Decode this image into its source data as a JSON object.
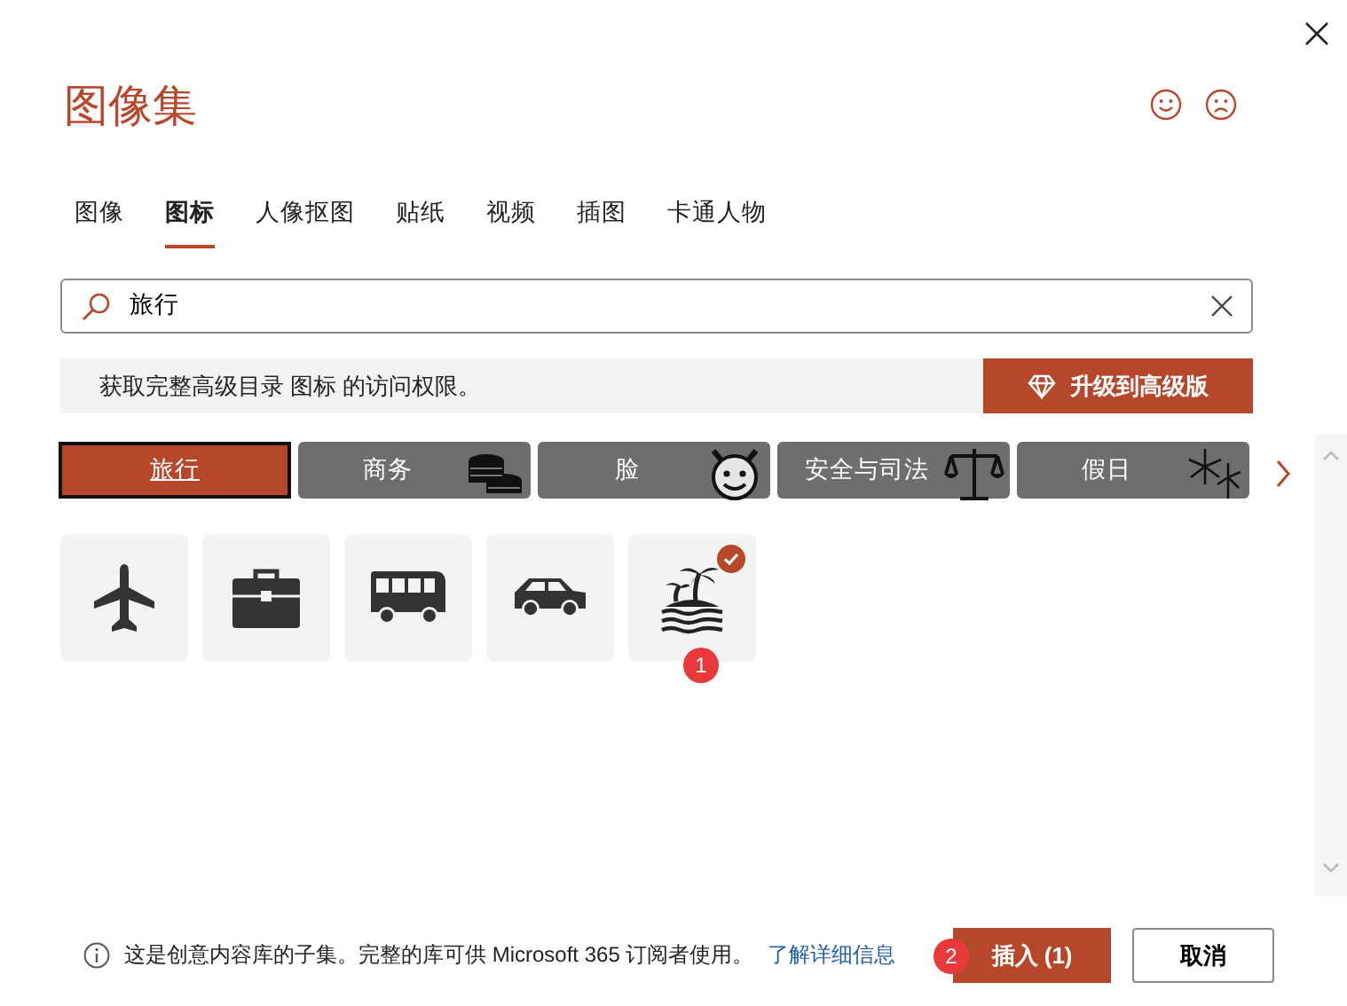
{
  "title": "图像集",
  "tabs": [
    {
      "label": "图像",
      "selected": false
    },
    {
      "label": "图标",
      "selected": true
    },
    {
      "label": "人像抠图",
      "selected": false
    },
    {
      "label": "贴纸",
      "selected": false
    },
    {
      "label": "视频",
      "selected": false
    },
    {
      "label": "插图",
      "selected": false
    },
    {
      "label": "卡通人物",
      "selected": false
    }
  ],
  "search": {
    "value": "旅行"
  },
  "banner": {
    "text": "获取完整高级目录 图标 的访问权限。",
    "button": "升级到高级版"
  },
  "categories": [
    {
      "label": "旅行",
      "selected": true,
      "kind": "none"
    },
    {
      "label": "商务",
      "selected": false,
      "kind": "coins"
    },
    {
      "label": "脸",
      "selected": false,
      "kind": "devil"
    },
    {
      "label": "安全与司法",
      "selected": false,
      "kind": "scales"
    },
    {
      "label": "假日",
      "selected": false,
      "kind": "fireworks"
    }
  ],
  "icons": [
    {
      "kind": "airplane",
      "selected": false
    },
    {
      "kind": "briefcase",
      "selected": false
    },
    {
      "kind": "bus",
      "selected": false
    },
    {
      "kind": "car",
      "selected": false
    },
    {
      "kind": "island",
      "selected": true,
      "marker": "1"
    }
  ],
  "footer": {
    "info": "这是创意内容库的子集。完整的库可供 Microsoft 365 订阅者使用。",
    "link": "了解详细信息",
    "insert": "插入 (1)",
    "insert_marker": "2",
    "cancel": "取消"
  }
}
